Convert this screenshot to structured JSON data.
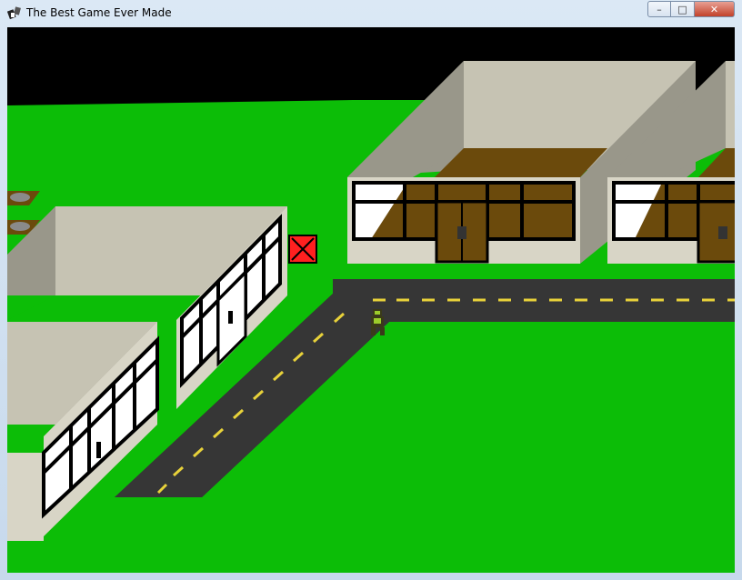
{
  "window": {
    "title": "The Best Game Ever Made",
    "controls": {
      "minimize_glyph": "–",
      "maximize_glyph": "□",
      "close_glyph": "✕"
    }
  },
  "game": {
    "colors": {
      "sky": "#000000",
      "grass": "#0cbd07",
      "road": "#363636",
      "road_stripe": "#e8d23a",
      "wall_light": "#c6c3b3",
      "wall_shade": "#99978a",
      "wall_front": "#d8d5c6",
      "floor_brown": "#6b4a0c",
      "glass": "#ffffff",
      "window_frame": "#000000",
      "crate": "#ff2020",
      "player_body": "#3a3a1a",
      "player_accent": "#9ccd2b"
    },
    "icons": {
      "crate": "crate-icon",
      "player": "player-character-icon",
      "rocks": "rock-icon"
    }
  }
}
